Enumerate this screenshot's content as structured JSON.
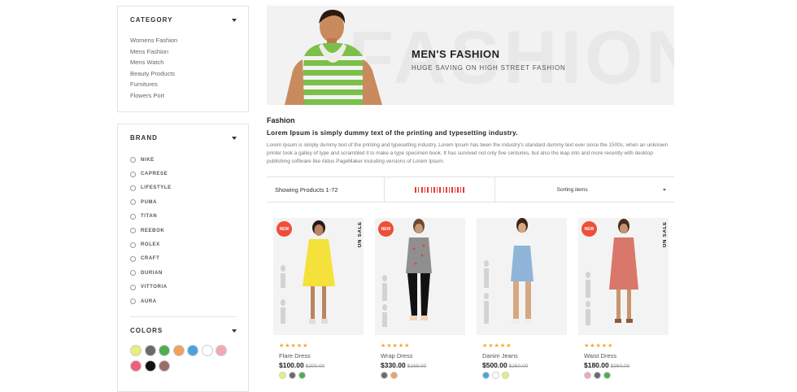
{
  "category": {
    "title": "CATEGORY",
    "items": [
      "Womens Fashion",
      "Mens Fashion",
      "Mens Watch",
      "Beauty Products",
      "Furnitures",
      "Flowers Port"
    ]
  },
  "brand": {
    "title": "BRAND",
    "items": [
      "NIKE",
      "CAPRESE",
      "LIFESTYLE",
      "PUMA",
      "TITAN",
      "REEBOK",
      "ROLEX",
      "CRAFT",
      "DURIAN",
      "VITTORIA",
      "AURA"
    ]
  },
  "colors": {
    "title": "COLORS",
    "swatches": [
      "#e8ee7a",
      "#6b6b6b",
      "#4caf50",
      "#f0a060",
      "#4aa3df",
      "#ffffff",
      "#f4a6b4",
      "#ef5f7a",
      "#111111",
      "#9e6b6b"
    ]
  },
  "banner": {
    "bg_word": "FASHION",
    "title": "MEN'S FASHION",
    "subtitle": "HUGE SAVING ON HIGH STREET FASHION"
  },
  "section": {
    "title": "Fashion",
    "lead": "Lorem Ipsum is simply dummy text of the printing and typesetting industry.",
    "body": "Lorem Ipsum is simply dummy text of the printing and typesetting industry. Lorem Ipsum has been the industry's standard dummy text ever since the 1500s, when an unknown printer took a galley of type and scrambled it to make a type specimen book. It has survived not only five centuries, but also the leap into and more recently with desktop publishing software like Aldus PageMaker including versions of Lorem Ipsum."
  },
  "toolbar": {
    "showing": "Showing Products 1-72",
    "sort_label": "Sorting items",
    "accent": "#e53935"
  },
  "products": [
    {
      "name": "Flare Dress",
      "price": "$100.00",
      "old_price": "$200.00",
      "badge": "NEW",
      "sale_label": "ON SALE",
      "stars": "★★★★★",
      "colors": [
        "#e8ee7a",
        "#6b6b6b",
        "#4caf50"
      ]
    },
    {
      "name": "Wrap Dress",
      "price": "$330.00",
      "old_price": "$165.00",
      "badge": "NEW",
      "sale_label": "",
      "stars": "★★★★★",
      "colors": [
        "#6b6b6b",
        "#f0a060"
      ]
    },
    {
      "name": "Danim Jeans",
      "price": "$500.00",
      "old_price": "$250.00",
      "badge": "",
      "sale_label": "",
      "stars": "★★★★★",
      "colors": [
        "#4aa3df",
        "#ffffff",
        "#e8ee7a"
      ]
    },
    {
      "name": "Waist Dress",
      "price": "$180.00",
      "old_price": "$360.00",
      "badge": "NEW",
      "sale_label": "ON SALE",
      "stars": "★★★★★",
      "colors": [
        "#f4a6b4",
        "#6b6b6b",
        "#4caf50"
      ]
    }
  ]
}
